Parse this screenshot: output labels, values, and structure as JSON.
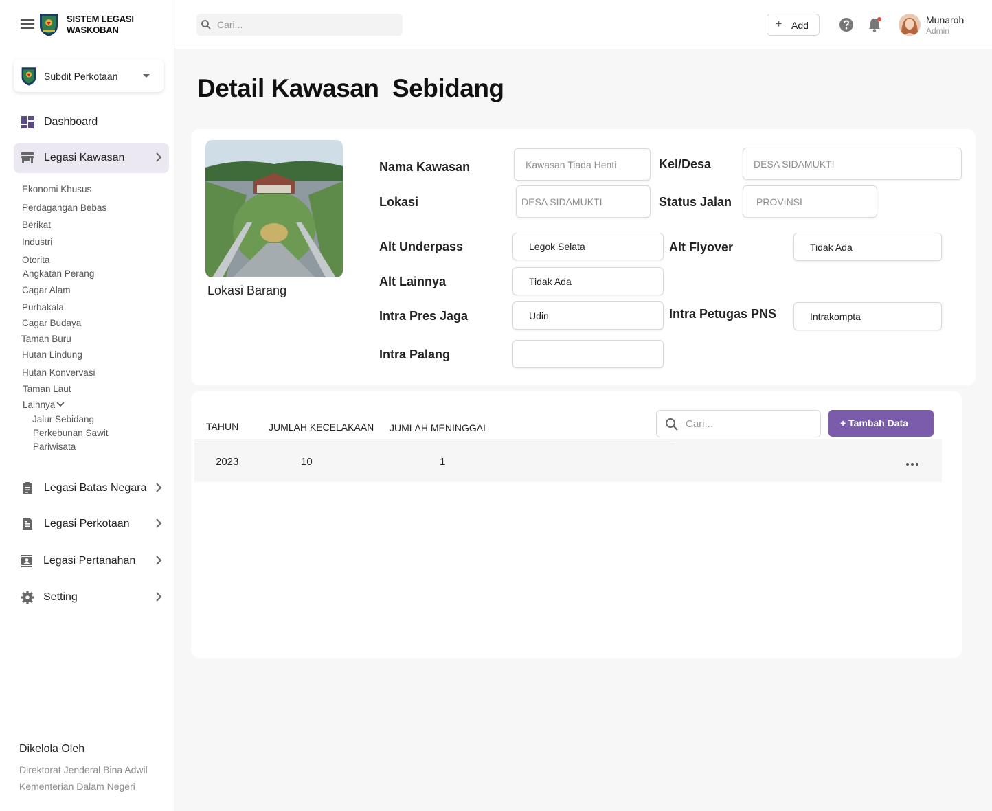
{
  "brand": {
    "line1": "SISTEM LEGASI",
    "line2": "WASKOBAN"
  },
  "org_selector": {
    "label": "Subdit Perkotaan"
  },
  "search_top": {
    "placeholder": "Cari..."
  },
  "header": {
    "add_label": "Add",
    "user_name": "Munaroh",
    "user_role": "Admin"
  },
  "sidebar": {
    "dashboard": "Dashboard",
    "legasi_kawasan": "Legasi Kawasan",
    "kawasan_items": [
      "Ekonomi Khusus",
      "Perdagangan Bebas",
      "Berikat",
      "Industri",
      "Otorita",
      "Angkatan Perang",
      "Cagar Alam",
      "Purbakala",
      "Cagar Budaya",
      "Taman Buru",
      "Hutan Lindung",
      "Hutan Konvervasi",
      "Taman Laut"
    ],
    "lainnya": "Lainnya",
    "lainnya_items": [
      "Jalur Sebidang",
      "Perkebunan Sawit",
      "Pariwisata"
    ],
    "batas_negara": "Legasi Batas Negara",
    "perkotaan": "Legasi Perkotaan",
    "pertanahan": "Legasi Pertanahan",
    "setting": "Setting"
  },
  "managed": {
    "title": "Dikelola Oleh",
    "line1": "Direktorat Jenderal Bina Adwil",
    "line2": "Kementerian Dalam Negeri"
  },
  "page_title": "Detail Kawasan  Sebidang",
  "photo_caption": "Lokasi Barang",
  "form": {
    "nama_kawasan": {
      "label": "Nama Kawasan",
      "value": "Kawasan Tiada Henti"
    },
    "kel_desa": {
      "label": "Kel/Desa",
      "value": "DESA SIDAMUKTI"
    },
    "lokasi": {
      "label": "Lokasi",
      "value": "DESA SIDAMUKTI"
    },
    "status_jalan": {
      "label": "Status Jalan",
      "value": "PROVINSI"
    },
    "alt_underpass": {
      "label": "Alt Underpass",
      "value": "Legok Selatan"
    },
    "alt_flyover": {
      "label": "Alt Flyover",
      "value": "Tidak Ada"
    },
    "alt_lainnya": {
      "label": "Alt Lainnya",
      "value": "Tidak Ada"
    },
    "intra_pres_jaga": {
      "label": "Intra Pres Jaga",
      "value": "Udin"
    },
    "intra_petugas_pns": {
      "label": "Intra Petugas PNS",
      "value": "Intrakompta"
    },
    "intra_palang": {
      "label": "Intra Palang",
      "value": ""
    }
  },
  "table": {
    "headers": [
      "TAHUN",
      "JUMLAH KECELAKAAN",
      "JUMLAH MENINGGAL"
    ],
    "rows": [
      {
        "tahun": "2023",
        "kecelakaan": "10",
        "meninggal": "1"
      }
    ],
    "search_placeholder": "Cari...",
    "add_button": "+ Tambah Data"
  },
  "colors": {
    "accent": "#7a5caa",
    "active_nav_bg": "#ebe8f1"
  }
}
